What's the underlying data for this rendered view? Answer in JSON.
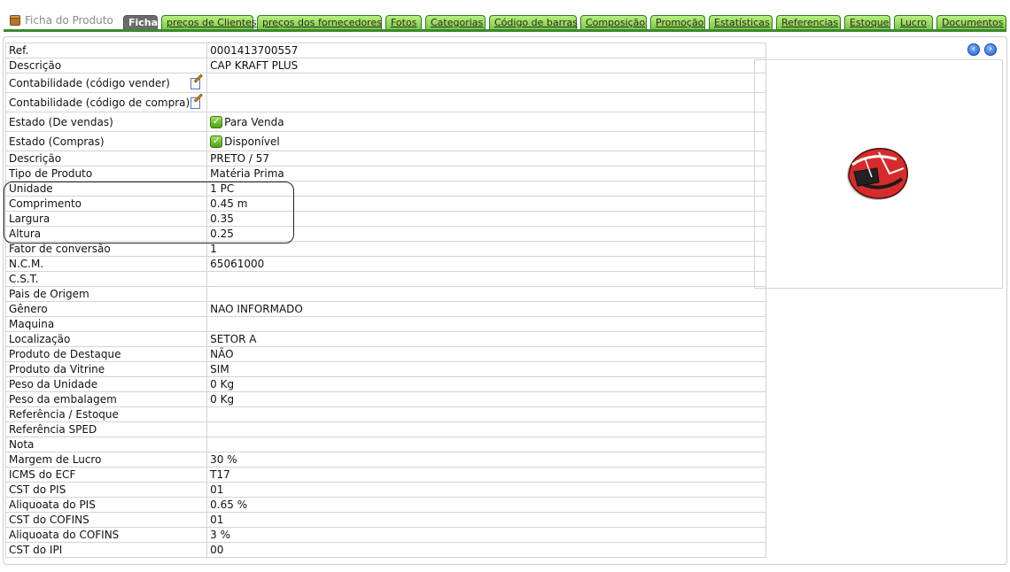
{
  "header": {
    "title": "Ficha do Produto"
  },
  "tabs": [
    {
      "label": "Ficha",
      "active": true
    },
    {
      "label": "preços de Clientes"
    },
    {
      "label": "preços dos fornecedores"
    },
    {
      "label": "Fotos"
    },
    {
      "label": "Categorias"
    },
    {
      "label": "Código de barras"
    },
    {
      "label": "Composição"
    },
    {
      "label": "Promoção"
    },
    {
      "label": "Estatísticas"
    },
    {
      "label": "Referencias"
    },
    {
      "label": "Estoque"
    },
    {
      "label": "Lucro"
    },
    {
      "label": "Documentos"
    }
  ],
  "rows": [
    {
      "label": "Ref.",
      "value": "0001413700557"
    },
    {
      "label": "Descrição",
      "value": "CAP KRAFT PLUS"
    },
    {
      "label": "Contabilidade (código vender)",
      "value": ""
    },
    {
      "label": "Contabilidade (código de compra)",
      "value": ""
    },
    {
      "label": "Estado (De vendas)",
      "value": "Para Venda"
    },
    {
      "label": "Estado (Compras)",
      "value": "Disponível"
    },
    {
      "label": "Descrição",
      "value": "PRETO / 57"
    },
    {
      "label": "Tipo de Produto",
      "value": "Matéria Prima"
    },
    {
      "label": "Unidade",
      "value": "1 PC"
    },
    {
      "label": "Comprimento",
      "value": "0.45 m"
    },
    {
      "label": "Largura",
      "value": "0.35"
    },
    {
      "label": "Altura",
      "value": "0.25"
    },
    {
      "label": "Fator de conversão",
      "value": "1"
    },
    {
      "label": "N.C.M.",
      "value": "65061000"
    },
    {
      "label": "C.S.T.",
      "value": ""
    },
    {
      "label": "Pais de Origem",
      "value": ""
    },
    {
      "label": "Gênero",
      "value": "NAO INFORMADO"
    },
    {
      "label": "Maquina",
      "value": ""
    },
    {
      "label": "Localização",
      "value": "SETOR A"
    },
    {
      "label": "Produto de Destaque",
      "value": "NÃO"
    },
    {
      "label": "Produto da Vitrine",
      "value": "SIM"
    },
    {
      "label": "Peso da Unidade",
      "value": "0 Kg"
    },
    {
      "label": "Peso da embalagem",
      "value": "0 Kg"
    },
    {
      "label": "Referência / Estoque",
      "value": ""
    },
    {
      "label": "Referência SPED",
      "value": ""
    },
    {
      "label": "Nota",
      "value": ""
    },
    {
      "label": "Margem de Lucro",
      "value": "30 %"
    },
    {
      "label": "ICMS do ECF",
      "value": "T17"
    },
    {
      "label": "CST do PIS",
      "value": "01"
    },
    {
      "label": "Aliquoata do PIS",
      "value": "0.65 %"
    },
    {
      "label": "CST do COFINS",
      "value": "01"
    },
    {
      "label": "Aliquoata do COFINS",
      "value": "3 %"
    },
    {
      "label": "CST do IPI",
      "value": "00"
    }
  ],
  "icons": {
    "title": "box-icon",
    "edit": "edit-icon",
    "status": "check-icon",
    "prev": "arrow-left-icon",
    "next": "arrow-right-icon"
  },
  "colors": {
    "tab_bg": "#9fe066",
    "tab_active": "#6b6b6b",
    "baseline": "#3a8a2c"
  }
}
